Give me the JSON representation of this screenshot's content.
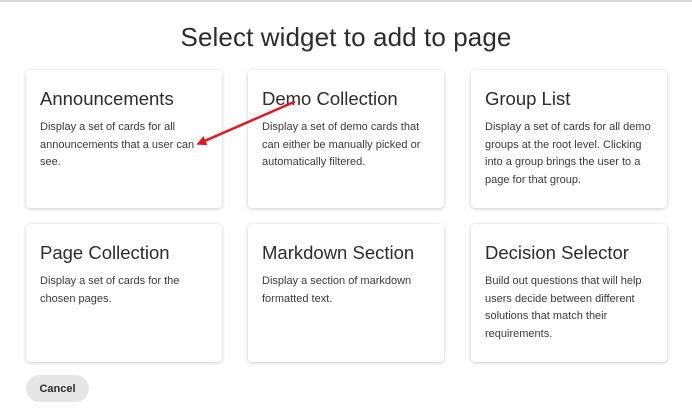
{
  "dialog": {
    "title": "Select widget to add to page"
  },
  "widgets": [
    {
      "title": "Announcements",
      "description": "Display a set of cards for all announcements that a user can see."
    },
    {
      "title": "Demo Collection",
      "description": "Display a set of demo cards that can either be manually picked or automatically filtered."
    },
    {
      "title": "Group List",
      "description": "Display a set of cards for all demo groups at the root level. Clicking into a group brings the user to a page for that group."
    },
    {
      "title": "Page Collection",
      "description": "Display a set of cards for the chosen pages."
    },
    {
      "title": "Markdown Section",
      "description": "Display a section of markdown formatted text."
    },
    {
      "title": "Decision Selector",
      "description": "Build out questions that will help users decide between different solutions that match their requirements."
    }
  ],
  "footer": {
    "cancel_label": "Cancel"
  },
  "colors": {
    "annotation_arrow": "#e8161b",
    "cancel_bg": "#e6e6e6",
    "text": "#2c2c2c"
  }
}
